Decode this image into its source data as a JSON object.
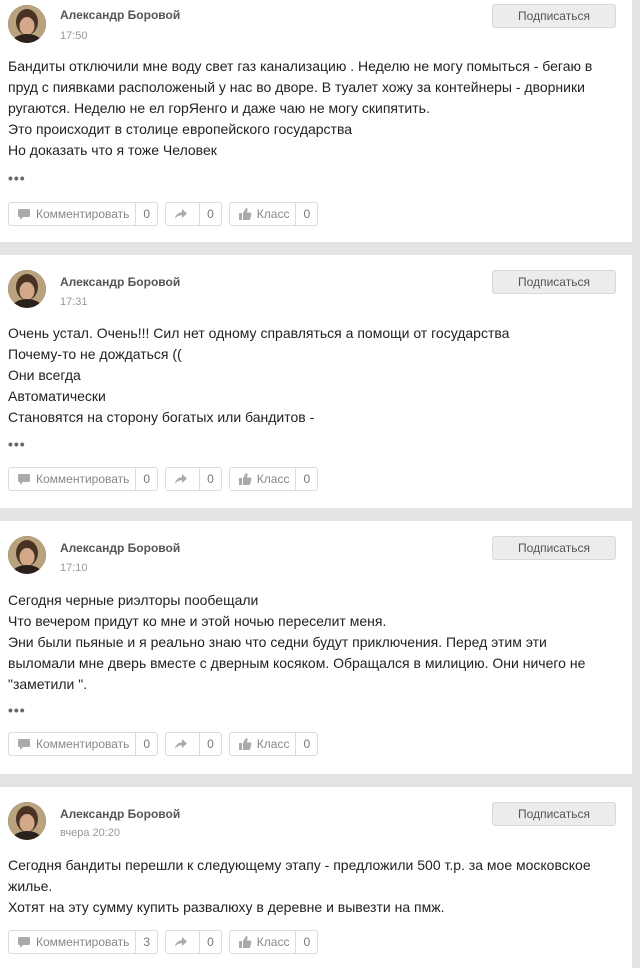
{
  "posts": [
    {
      "author": "Александр Боровой",
      "time": "17:50",
      "subscribe_label": "Подписаться",
      "lines": [
        "Бандиты отключили мне воду свет газ канализацию . Неделю не могу помыться  -  бегаю в",
        "пруд с пиявками расположеный у нас во дворе. В туалет хожу за контейнеры  -  дворники",
        "ругаются. Неделю не ел горЯенго и даже чаю не могу скипятить.",
        "Это происходит в столице европейского государства",
        "Но доказать что я тоже  Человек"
      ],
      "more": "•••",
      "comment_label": "Комментировать",
      "comment_count": "0",
      "share_count": "0",
      "like_label": "Класс",
      "like_count": "0"
    },
    {
      "author": "Александр Боровой",
      "time": "17:31",
      "subscribe_label": "Подписаться",
      "lines": [
        "Очень устал.  Очень!!! Сил нет одному справляться а помощи от государства",
        "Почему-то не дождаться  ((",
        "Они всегда",
        "Автоматически",
        "Становятся на сторону богатых или бандитов  -"
      ],
      "more": "•••",
      "comment_label": "Комментировать",
      "comment_count": "0",
      "share_count": "0",
      "like_label": "Класс",
      "like_count": "0"
    },
    {
      "author": "Александр Боровой",
      "time": "17:10",
      "subscribe_label": "Подписаться",
      "lines": [
        "Сегодня черные риэлторы пообещали",
        "Что вечером придут ко мне и этой ночью переселит меня.",
        "Эни были пьяные и я реально знаю что седни будут приключения. Перед этим эти",
        "выломали мне дверь вместе с дверным  косяком. Обращался в милицию. Они ничего не",
        "\"заметили \"."
      ],
      "more": "•••",
      "comment_label": "Комментировать",
      "comment_count": "0",
      "share_count": "0",
      "like_label": "Класс",
      "like_count": "0"
    },
    {
      "author": "Александр Боровой",
      "time": "вчера 20:20",
      "subscribe_label": "Подписаться",
      "lines": [
        "Сегодня бандиты перешли к следующему этапу  -  предложили 500 т.р. за мое московское",
        "жилье.",
        "Хотят на эту сумму купить развалюху в деревне и вывезти на пмж."
      ],
      "more": "",
      "comment_label": "Комментировать",
      "comment_count": "3",
      "share_count": "0",
      "like_label": "Класс",
      "like_count": "0"
    }
  ]
}
